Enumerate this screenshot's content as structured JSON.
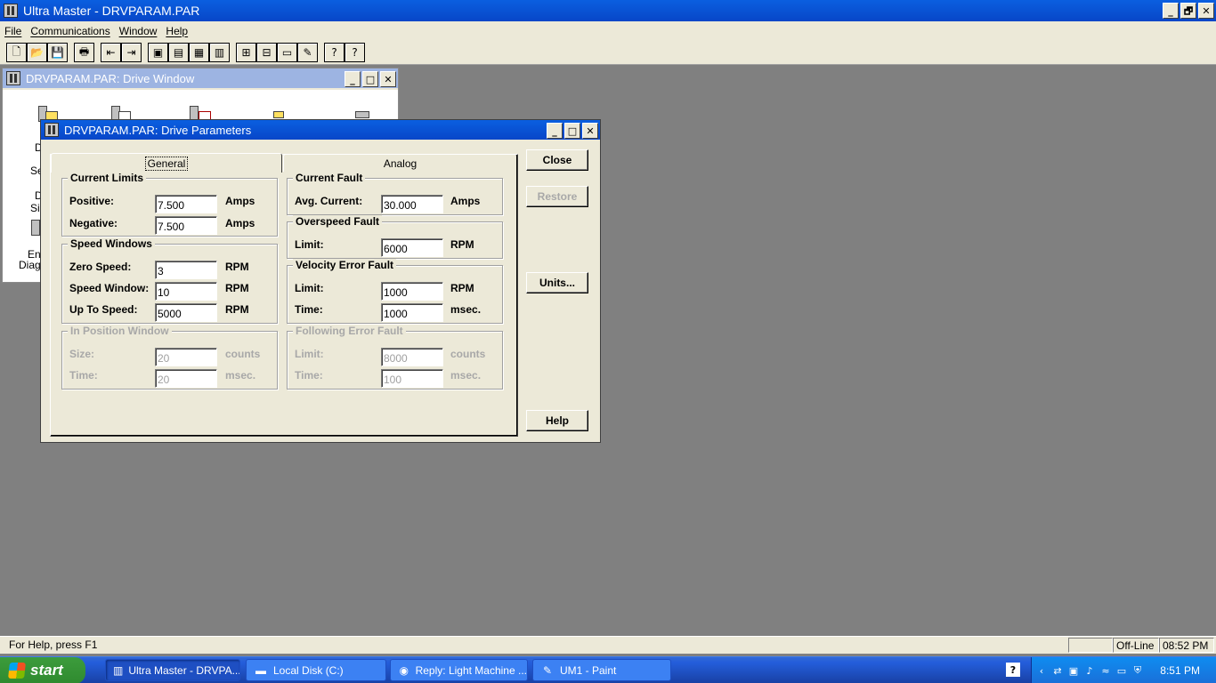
{
  "app": {
    "title": "Ultra Master - DRVPARAM.PAR",
    "window_buttons": {
      "minimize": "_",
      "restore": "🗗",
      "close": "✕"
    }
  },
  "menu": [
    "File",
    "Communications",
    "Window",
    "Help"
  ],
  "toolbar": {
    "buttons": [
      "new-icon",
      "open-icon",
      "save-icon",
      "print-icon",
      "upload-icon",
      "download-icon",
      "drive-setup-icon",
      "drive-signals-icon",
      "io-icon",
      "encoder-icon",
      "monitor-icon",
      "scope-icon",
      "display-icon",
      "tune-icon",
      "help-icon",
      "context-help-icon"
    ],
    "glyphs": [
      "🗋",
      "📂",
      "💾",
      "🖶",
      "⇤",
      "⇥",
      "▣",
      "▤",
      "▦",
      "▥",
      "⊞",
      "⊟",
      "▭",
      "✎",
      "?",
      "?"
    ]
  },
  "drive_window": {
    "title": "DRVPARAM.PAR: Drive Window",
    "fragments": [
      "D",
      "Se",
      "D",
      "Si",
      "En",
      "Diag"
    ]
  },
  "params": {
    "title": "DRVPARAM.PAR: Drive Parameters",
    "tabs": {
      "general": "General",
      "analog": "Analog"
    },
    "current_limits": {
      "title": "Current Limits",
      "positive_label": "Positive:",
      "positive_value": "7.500",
      "positive_unit": "Amps",
      "negative_label": "Negative:",
      "negative_value": "7.500",
      "negative_unit": "Amps"
    },
    "speed_windows": {
      "title": "Speed Windows",
      "zero_label": "Zero Speed:",
      "zero_value": "3",
      "zero_unit": "RPM",
      "window_label": "Speed Window:",
      "window_value": "10",
      "window_unit": "RPM",
      "upto_label": "Up To Speed:",
      "upto_value": "5000",
      "upto_unit": "RPM"
    },
    "in_position": {
      "title": "In Position Window",
      "size_label": "Size:",
      "size_value": "20",
      "size_unit": "counts",
      "time_label": "Time:",
      "time_value": "20",
      "time_unit": "msec."
    },
    "current_fault": {
      "title": "Current Fault",
      "avg_label": "Avg. Current:",
      "avg_value": "30.000",
      "avg_unit": "Amps"
    },
    "overspeed_fault": {
      "title": "Overspeed Fault",
      "limit_label": "Limit:",
      "limit_value": "6000",
      "limit_unit": "RPM"
    },
    "velocity_error": {
      "title": "Velocity Error Fault",
      "limit_label": "Limit:",
      "limit_value": "1000",
      "limit_unit": "RPM",
      "time_label": "Time:",
      "time_value": "1000",
      "time_unit": "msec."
    },
    "following_error": {
      "title": "Following Error Fault",
      "limit_label": "Limit:",
      "limit_value": "8000",
      "limit_unit": "counts",
      "time_label": "Time:",
      "time_value": "100",
      "time_unit": "msec."
    },
    "buttons": {
      "close": "Close",
      "restore": "Restore",
      "units": "Units...",
      "help": "Help"
    }
  },
  "status": {
    "help_text": "For Help, press F1",
    "mode": "Off-Line",
    "time": "08:52 PM"
  },
  "taskbar": {
    "start": "start",
    "tasks": [
      {
        "label": "Ultra Master - DRVPA...",
        "icon": "ultra-master-icon"
      },
      {
        "label": "Local Disk (C:)",
        "icon": "disk-icon"
      },
      {
        "label": "Reply: Light Machine ...",
        "icon": "firefox-icon"
      },
      {
        "label": "UM1 - Paint",
        "icon": "paint-icon"
      }
    ],
    "clock": "8:51 PM"
  }
}
